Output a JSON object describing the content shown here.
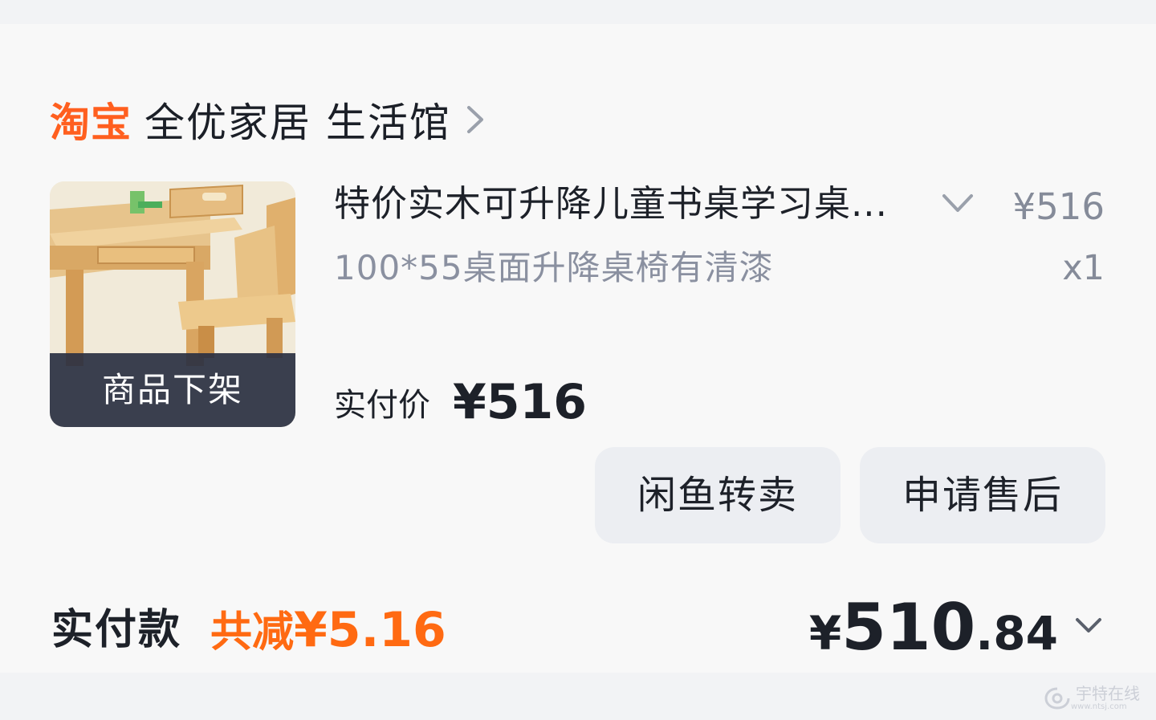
{
  "shop": {
    "brand": "淘宝",
    "name": "全优家居 生活馆"
  },
  "product": {
    "title": "特价实木可升降儿童书桌学习桌...",
    "unit_price": "¥516",
    "sku": "100*55桌面升降桌椅有清漆",
    "quantity": "x1",
    "status_overlay": "商品下架",
    "paid_label": "实付价",
    "paid_value": "¥516"
  },
  "actions": {
    "resell_label": "闲鱼转卖",
    "aftersale_label": "申请售后"
  },
  "summary": {
    "label": "实付款",
    "discount_prefix": "共减",
    "discount_amount": "¥5.16",
    "total_currency": "¥",
    "total_integer": "510",
    "total_decimal": ".84"
  },
  "watermark": {
    "text": "宇特在线",
    "sub": "www.ntsj.com"
  },
  "colors": {
    "accent": "#ff6a12",
    "text": "#1d2129",
    "muted": "#8a90a0",
    "button_bg": "#eceef2",
    "overlay": "#2a3042"
  }
}
